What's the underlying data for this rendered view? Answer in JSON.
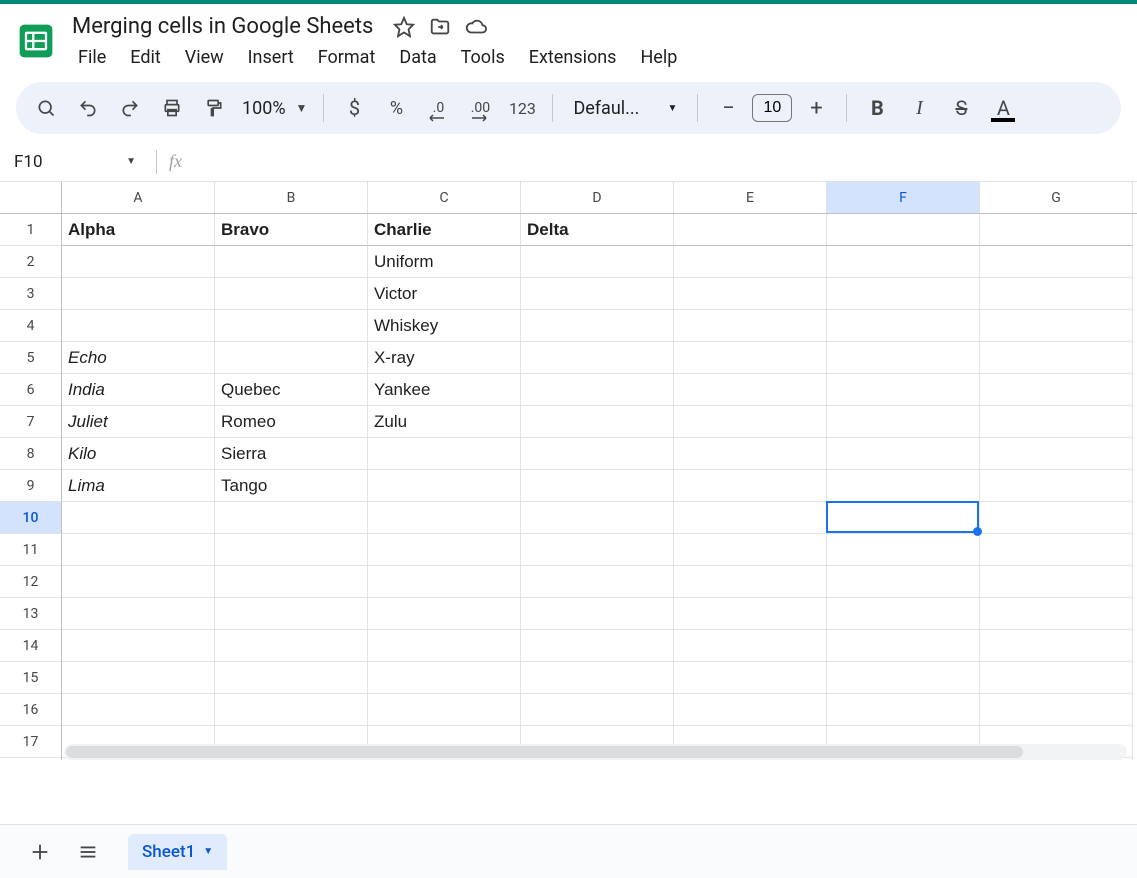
{
  "doc": {
    "title": "Merging cells in Google Sheets"
  },
  "menubar": [
    "File",
    "Edit",
    "View",
    "Insert",
    "Format",
    "Data",
    "Tools",
    "Extensions",
    "Help"
  ],
  "toolbar": {
    "zoom": "100%",
    "font": "Defaul...",
    "font_size": "10",
    "currency": "$",
    "percent": "%",
    "dec_dec": ".0",
    "inc_dec": ".00",
    "number_fmt": "123",
    "bold": "B",
    "italic": "I",
    "strike": "S",
    "textcolor": "A"
  },
  "namebox": {
    "ref": "F10"
  },
  "columns": [
    "A",
    "B",
    "C",
    "D",
    "E",
    "F",
    "G"
  ],
  "rows_shown": 18,
  "selected_col_index": 5,
  "selected_row_index": 9,
  "chart_data": {
    "type": "table",
    "headers": [
      "Alpha",
      "Bravo",
      "Charlie",
      "Delta"
    ],
    "cells": {
      "A1": "Alpha",
      "B1": "Bravo",
      "C1": "Charlie",
      "D1": "Delta",
      "C2": "Uniform",
      "C3": "Victor",
      "C4": "Whiskey",
      "A5": "Echo",
      "C5": "X-ray",
      "A6": "India",
      "B6": "Quebec",
      "C6": "Yankee",
      "A7": "Juliet",
      "B7": "Romeo",
      "C7": "Zulu",
      "A8": "Kilo",
      "B8": "Sierra",
      "A9": "Lima",
      "B9": "Tango"
    },
    "styles": {
      "bold": [
        "A1",
        "B1",
        "C1",
        "D1"
      ],
      "italic": [
        "A5",
        "A6",
        "A7",
        "A8",
        "A9"
      ]
    }
  },
  "sheets": {
    "active": "Sheet1"
  }
}
